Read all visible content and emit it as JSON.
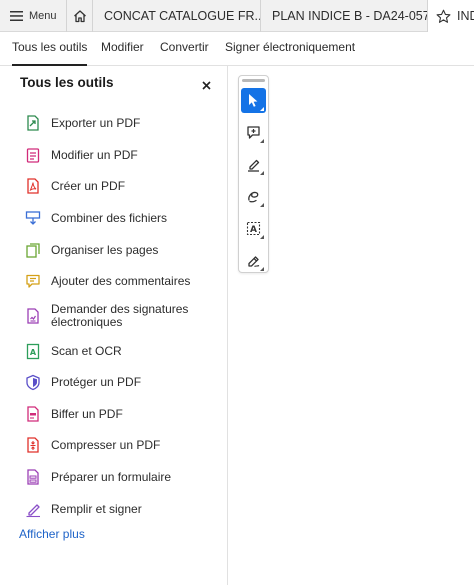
{
  "tabstrip": {
    "menu_label": "Menu",
    "tabs": [
      {
        "label": "CONCAT CATALOGUE FR..."
      },
      {
        "label": "PLAN INDICE B - DA24-057..."
      },
      {
        "label": "IND"
      }
    ]
  },
  "topnav": {
    "items": [
      {
        "label": "Tous les outils",
        "active": true
      },
      {
        "label": "Modifier"
      },
      {
        "label": "Convertir"
      },
      {
        "label": "Signer électroniquement"
      }
    ]
  },
  "panel": {
    "title": "Tous les outils",
    "tools": [
      {
        "label": "Exporter un PDF",
        "icon": "export-pdf-icon",
        "color": "#2d8a4e"
      },
      {
        "label": "Modifier un PDF",
        "icon": "edit-pdf-icon",
        "color": "#d12b7a"
      },
      {
        "label": "Créer un PDF",
        "icon": "create-pdf-icon",
        "color": "#e0312a"
      },
      {
        "label": "Combiner des fichiers",
        "icon": "combine-files-icon",
        "color": "#3b6fd6"
      },
      {
        "label": "Organiser les pages",
        "icon": "organize-pages-icon",
        "color": "#6aa633"
      },
      {
        "label": "Ajouter des commentaires",
        "icon": "comment-icon",
        "color": "#d4a017"
      },
      {
        "label": "Demander des signatures électroniques",
        "icon": "request-signature-icon",
        "color": "#9b3fb5"
      },
      {
        "label": "Scan et OCR",
        "icon": "scan-ocr-icon",
        "color": "#2d9e5a"
      },
      {
        "label": "Protéger un PDF",
        "icon": "protect-pdf-icon",
        "color": "#5a4fc8"
      },
      {
        "label": "Biffer un PDF",
        "icon": "redact-pdf-icon",
        "color": "#d12b7a"
      },
      {
        "label": "Compresser un PDF",
        "icon": "compress-pdf-icon",
        "color": "#e0312a"
      },
      {
        "label": "Préparer un formulaire",
        "icon": "prepare-form-icon",
        "color": "#9b3fb5"
      },
      {
        "label": "Remplir et signer",
        "icon": "fill-sign-icon",
        "color": "#8a4fc8"
      }
    ],
    "more_label": "Afficher plus"
  },
  "quickbar": {
    "tools": [
      {
        "icon": "select-cursor-icon",
        "selected": true
      },
      {
        "icon": "add-comment-icon"
      },
      {
        "icon": "highlight-pen-icon"
      },
      {
        "icon": "freehand-draw-icon"
      },
      {
        "icon": "text-select-icon"
      },
      {
        "icon": "sign-pen-icon"
      }
    ]
  },
  "colors": {
    "accent": "#1473e6",
    "link": "#1e63c8"
  }
}
